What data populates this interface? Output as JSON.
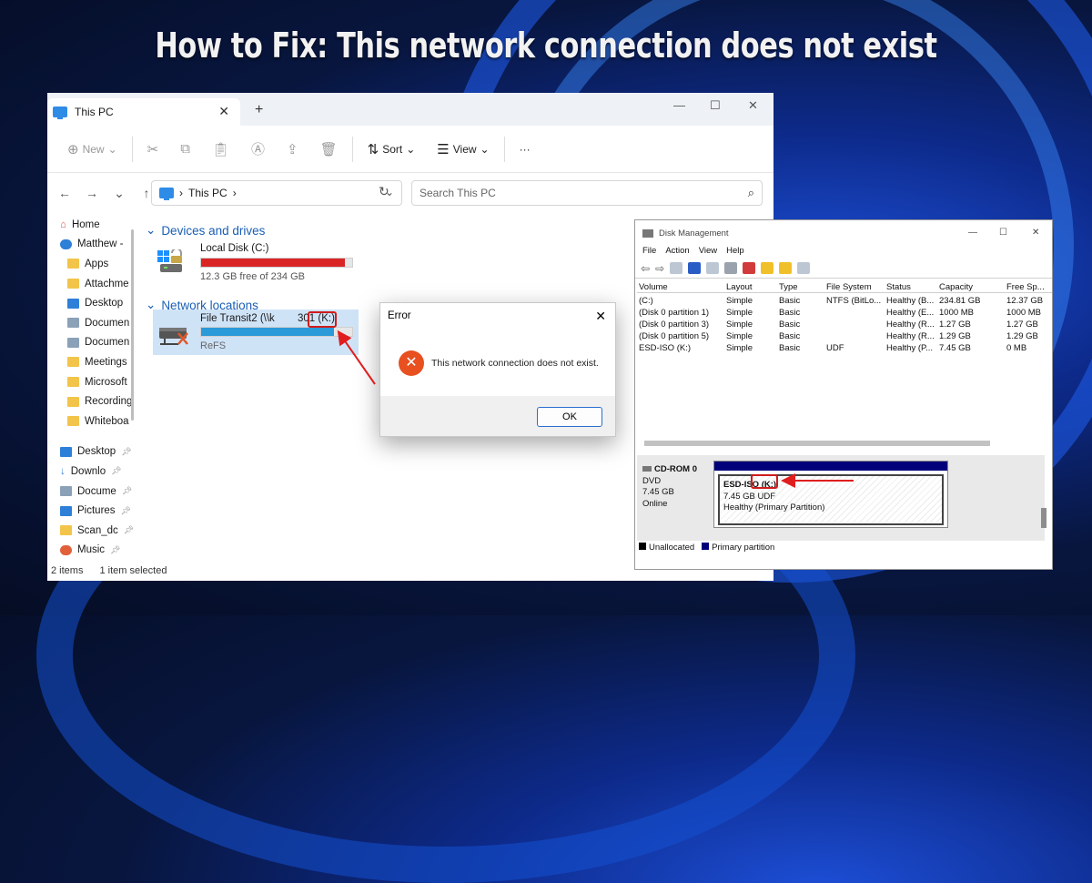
{
  "headline": "How to Fix: This network connection does not exist",
  "explorer": {
    "tab_title": "This PC",
    "toolbar": {
      "new": "New",
      "sort": "Sort",
      "view": "View",
      "more": "···"
    },
    "address": {
      "path": "This PC",
      "sep": "›"
    },
    "search_placeholder": "Search This PC",
    "sidebar": [
      "Home",
      "Matthew -",
      "Apps",
      "Attachme",
      "Desktop",
      "Documen",
      "Documen",
      "Meetings",
      "Microsoft",
      "Recording",
      "Whiteboa",
      "Desktop",
      "Downlo",
      "Docume",
      "Pictures",
      "Scan_dc",
      "Music"
    ],
    "devices_header": "Devices and drives",
    "local_disk": {
      "name": "Local Disk (C:)",
      "free": "12.3 GB free of 234 GB",
      "used_fraction": 0.95
    },
    "network_header": "Network locations",
    "net_drive": {
      "name": "File Transit2 (\\\\k",
      "suffix": "301 (K:)",
      "fs": "ReFS",
      "used_fraction": 0.88
    },
    "status": {
      "items": "2 items",
      "selected": "1 item selected"
    }
  },
  "dialog": {
    "title": "Error",
    "message": "This network connection does not exist.",
    "ok": "OK"
  },
  "disk_mgmt": {
    "title": "Disk Management",
    "menu": [
      "File",
      "Action",
      "View",
      "Help"
    ],
    "columns": [
      "Volume",
      "Layout",
      "Type",
      "File System",
      "Status",
      "Capacity",
      "Free Sp..."
    ],
    "rows": [
      [
        "(C:)",
        "Simple",
        "Basic",
        "NTFS (BitLo...",
        "Healthy (B...",
        "234.81 GB",
        "12.37 GB"
      ],
      [
        "(Disk 0 partition 1)",
        "Simple",
        "Basic",
        "",
        "Healthy (E...",
        "1000 MB",
        "1000 MB"
      ],
      [
        "(Disk 0 partition 3)",
        "Simple",
        "Basic",
        "",
        "Healthy (R...",
        "1.27 GB",
        "1.27 GB"
      ],
      [
        "(Disk 0 partition 5)",
        "Simple",
        "Basic",
        "",
        "Healthy (R...",
        "1.29 GB",
        "1.29 GB"
      ],
      [
        "ESD-ISO (K:)",
        "Simple",
        "Basic",
        "UDF",
        "Healthy (P...",
        "7.45 GB",
        "0 MB"
      ]
    ],
    "disk": {
      "name": "CD-ROM 0",
      "type": "DVD",
      "size": "7.45 GB",
      "state": "Online"
    },
    "partition": {
      "name": "ESD-ISO",
      "letter": "(K:)",
      "size": "7.45 GB UDF",
      "status": "Healthy (Primary Partition)"
    },
    "legend": [
      "Unallocated",
      "Primary partition"
    ]
  }
}
